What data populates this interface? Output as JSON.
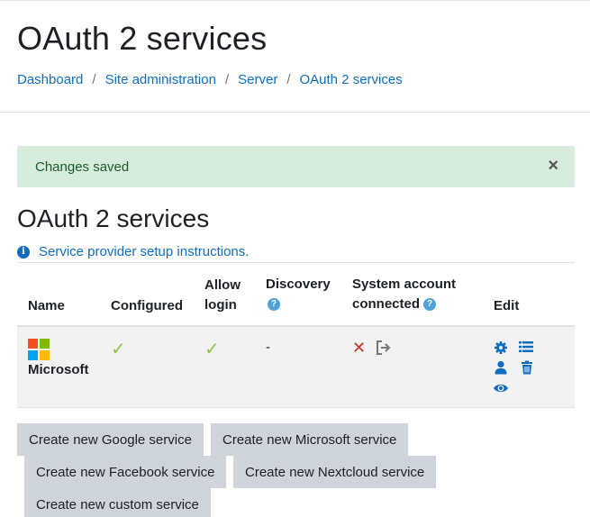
{
  "header": {
    "title": "OAuth 2 services",
    "breadcrumb": [
      "Dashboard",
      "Site administration",
      "Server",
      "OAuth 2 services"
    ]
  },
  "alert": {
    "message": "Changes saved",
    "close": "×"
  },
  "section": {
    "title": "OAuth 2 services",
    "info_link": "Service provider setup instructions."
  },
  "table": {
    "headers": {
      "name": "Name",
      "configured": "Configured",
      "allow_login_1": "Allow",
      "allow_login_2": "login",
      "discovery": "Discovery",
      "system_account_1": "System account",
      "system_account_2": "connected",
      "edit": "Edit"
    },
    "rows": [
      {
        "name": "Microsoft",
        "configured": "✓",
        "allow_login": "✓",
        "discovery": "-",
        "system_account": "✕"
      }
    ]
  },
  "buttons": {
    "google": "Create new Google service",
    "microsoft": "Create new Microsoft service",
    "facebook": "Create new Facebook service",
    "nextcloud": "Create new Nextcloud service",
    "custom": "Create new custom service"
  },
  "colors": {
    "link": "#0f6cbf",
    "alert_bg": "#d7ecdc",
    "check": "#8cc63f",
    "cross": "#ca3120",
    "ms_red": "#f25022",
    "ms_green": "#7fba00",
    "ms_blue": "#00a4ef",
    "ms_yellow": "#ffb900"
  }
}
